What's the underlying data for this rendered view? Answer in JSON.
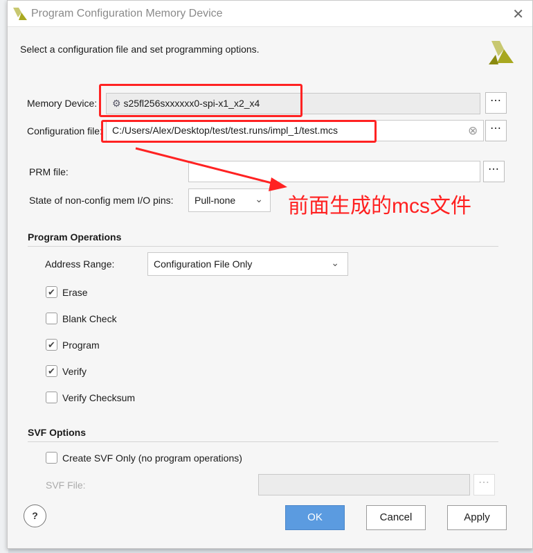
{
  "window": {
    "title": "Program Configuration Memory Device"
  },
  "description": "Select a configuration file and set programming options.",
  "memory_device": {
    "label": "Memory Device:",
    "value": "s25fl256sxxxxxx0-spi-x1_x2_x4"
  },
  "config_file": {
    "label": "Configuration file:",
    "value": "C:/Users/Alex/Desktop/test/test.runs/impl_1/test.mcs"
  },
  "prm_file": {
    "label": "PRM file:",
    "value": ""
  },
  "io_pins": {
    "label": "State of non-config mem I/O pins:",
    "value": "Pull-none"
  },
  "program_operations": {
    "title": "Program Operations",
    "address_range_label": "Address Range:",
    "address_range_value": "Configuration File Only",
    "options": [
      {
        "label": "Erase",
        "checked": true
      },
      {
        "label": "Blank Check",
        "checked": false
      },
      {
        "label": "Program",
        "checked": true
      },
      {
        "label": "Verify",
        "checked": true
      },
      {
        "label": "Verify Checksum",
        "checked": false
      }
    ]
  },
  "svf_options": {
    "title": "SVF Options",
    "create_label": "Create SVF Only (no program operations)",
    "create_checked": false,
    "file_label": "SVF File:",
    "file_value": ""
  },
  "buttons": {
    "help": "?",
    "ok": "OK",
    "cancel": "Cancel",
    "apply": "Apply",
    "browse": "⋯"
  },
  "annotation": {
    "text": "前面生成的mcs文件",
    "color": "#ff2020"
  },
  "colors": {
    "ok_button": "#5b9be0",
    "logo": "#a8a820"
  }
}
